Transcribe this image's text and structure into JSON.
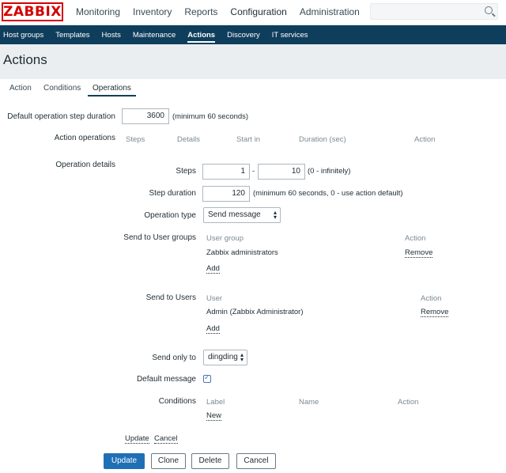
{
  "brand": {
    "logo": "ZABBIX"
  },
  "main_nav": [
    "Monitoring",
    "Inventory",
    "Reports",
    "Configuration",
    "Administration"
  ],
  "sub_nav": [
    "Host groups",
    "Templates",
    "Hosts",
    "Maintenance",
    "Actions",
    "Discovery",
    "IT services"
  ],
  "page_title": "Actions",
  "tabs": [
    "Action",
    "Conditions",
    "Operations"
  ],
  "form": {
    "default_step_duration_label": "Default operation step duration",
    "default_step_duration_value": "3600",
    "default_step_duration_hint": "(minimum 60 seconds)",
    "action_operations_label": "Action operations",
    "action_operations_cols": [
      "Steps",
      "Details",
      "Start in",
      "Duration (sec)",
      "Action"
    ],
    "operation_details_label": "Operation details",
    "steps_label": "Steps",
    "steps_from": "1",
    "steps_sep": "-",
    "steps_to": "10",
    "steps_hint": "(0 - infinitely)",
    "step_duration_label": "Step duration",
    "step_duration_value": "120",
    "step_duration_hint": "(minimum 60 seconds, 0 - use action default)",
    "operation_type_label": "Operation type",
    "operation_type_value": "Send message",
    "send_user_groups_label": "Send to User groups",
    "user_group_col": "User group",
    "user_group_action_col": "Action",
    "user_group_row": "Zabbix administrators",
    "remove_label": "Remove",
    "add_label": "Add",
    "send_users_label": "Send to Users",
    "user_col": "User",
    "user_action_col": "Action",
    "user_row": "Admin (Zabbix Administrator)",
    "send_only_to_label": "Send only to",
    "send_only_to_value": "dingding",
    "default_message_label": "Default message",
    "conditions_label": "Conditions",
    "conditions_cols": [
      "Label",
      "Name",
      "Action"
    ],
    "new_label": "New",
    "update_link": "Update",
    "cancel_link": "Cancel"
  },
  "buttons": {
    "update": "Update",
    "clone": "Clone",
    "delete": "Delete",
    "cancel": "Cancel"
  }
}
